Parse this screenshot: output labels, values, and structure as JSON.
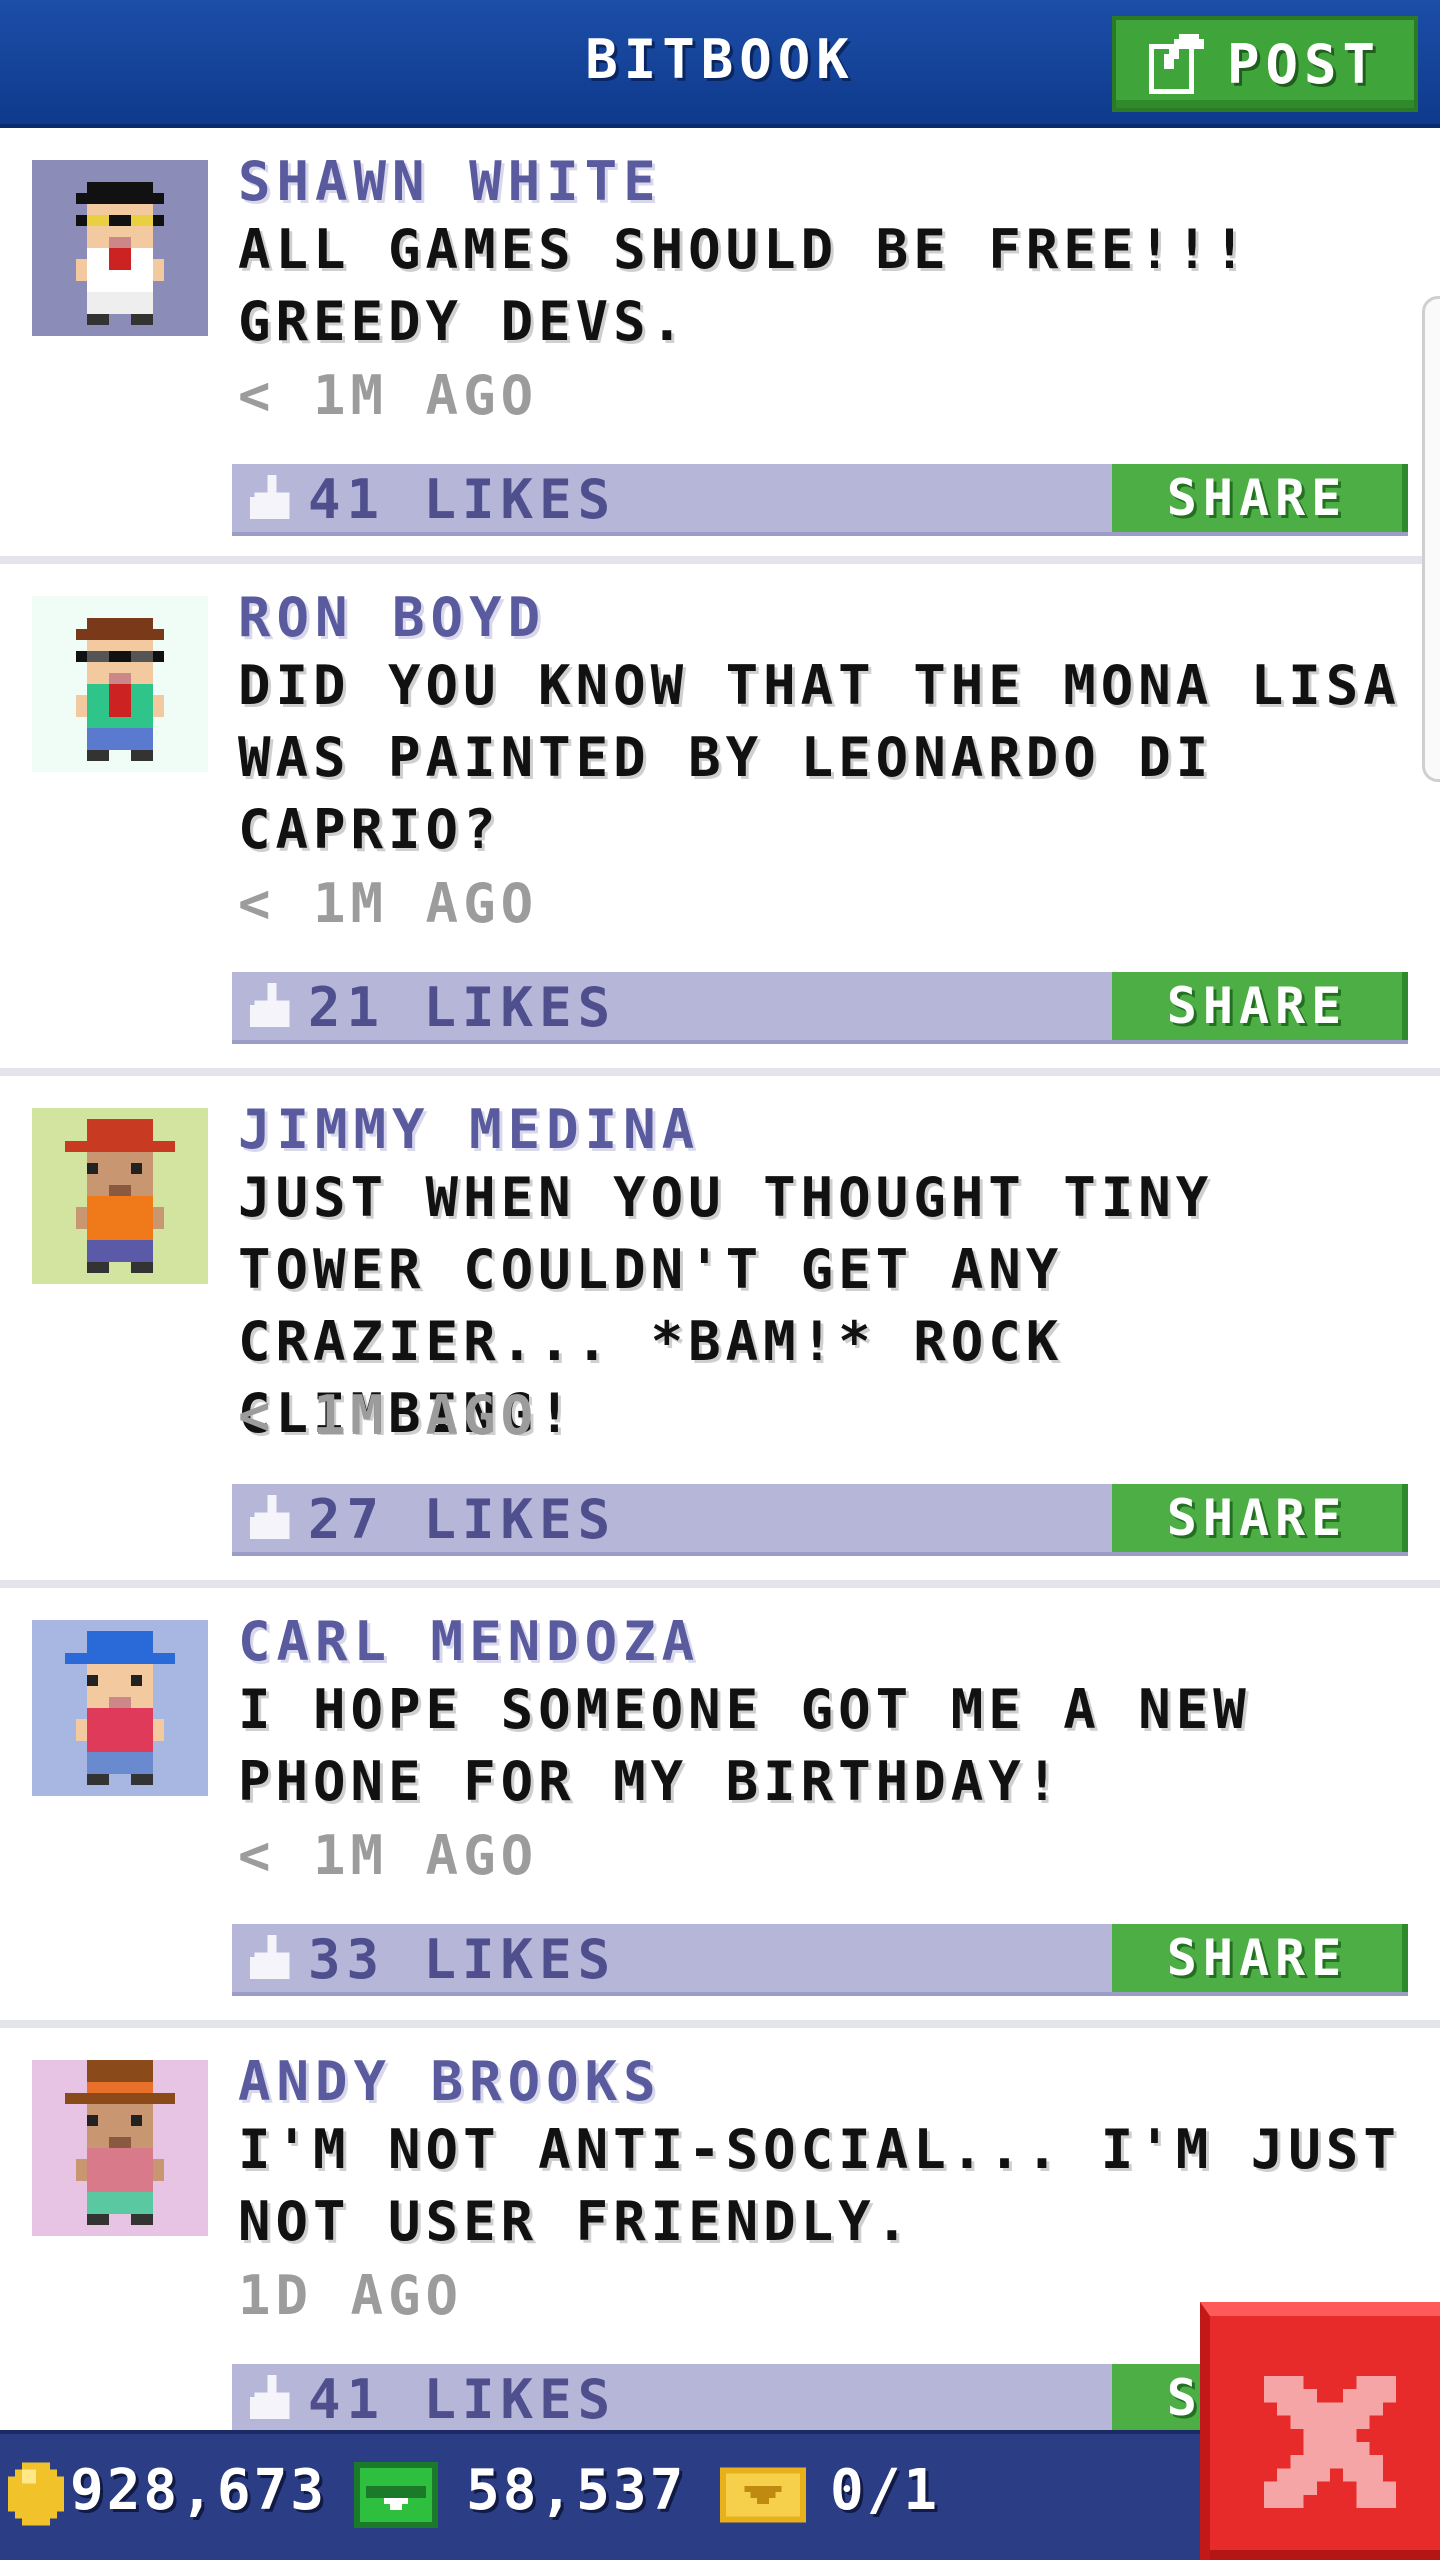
{
  "header": {
    "title": "BITBOOK",
    "post_label": "POST",
    "post_icon": "edit-icon"
  },
  "posts": [
    {
      "author": "SHAWN WHITE",
      "message": "ALL GAMES SHOULD BE FREE!!! GREEDY DEVS.",
      "time": "< 1M AGO",
      "likes": "41 LIKES",
      "share_label": "SHARE",
      "avatar_bg": "#8c8cb8"
    },
    {
      "author": "RON BOYD",
      "message": "DID YOU KNOW THAT THE MONA LISA WAS PAINTED BY LEONARDO DI CAPRIO?",
      "time": "< 1M AGO",
      "likes": "21 LIKES",
      "share_label": "SHARE",
      "avatar_bg": "#f0fcf6"
    },
    {
      "author": "JIMMY MEDINA",
      "message": "JUST WHEN YOU THOUGHT TINY TOWER COULDN'T GET ANY CRAZIER... *BAM!* ROCK CLIMBING!",
      "time": "< 1M AGO",
      "likes": "27 LIKES",
      "share_label": "SHARE",
      "avatar_bg": "#d2e4a0"
    },
    {
      "author": "CARL MENDOZA",
      "message": "I HOPE SOMEONE GOT ME A NEW PHONE FOR MY BIRTHDAY!",
      "time": "< 1M AGO",
      "likes": "33 LIKES",
      "share_label": "SHARE",
      "avatar_bg": "#a8b6e2"
    },
    {
      "author": "ANDY BROOKS",
      "message": "I'M NOT ANTI-SOCIAL... I'M JUST NOT USER FRIENDLY.",
      "time": "1D AGO",
      "likes": "41 LIKES",
      "share_label": "SHARE",
      "avatar_bg": "#e8c4e4"
    }
  ],
  "bottom_bar": {
    "coins": "928,673",
    "bux": "58,537",
    "tickets": "0/1"
  },
  "colors": {
    "header_blue": "#1c4ea8",
    "share_green": "#4cae45",
    "likes_bar": "#b5b6d8",
    "author_purple": "#5a5a9e",
    "close_red": "#e72a2a"
  }
}
